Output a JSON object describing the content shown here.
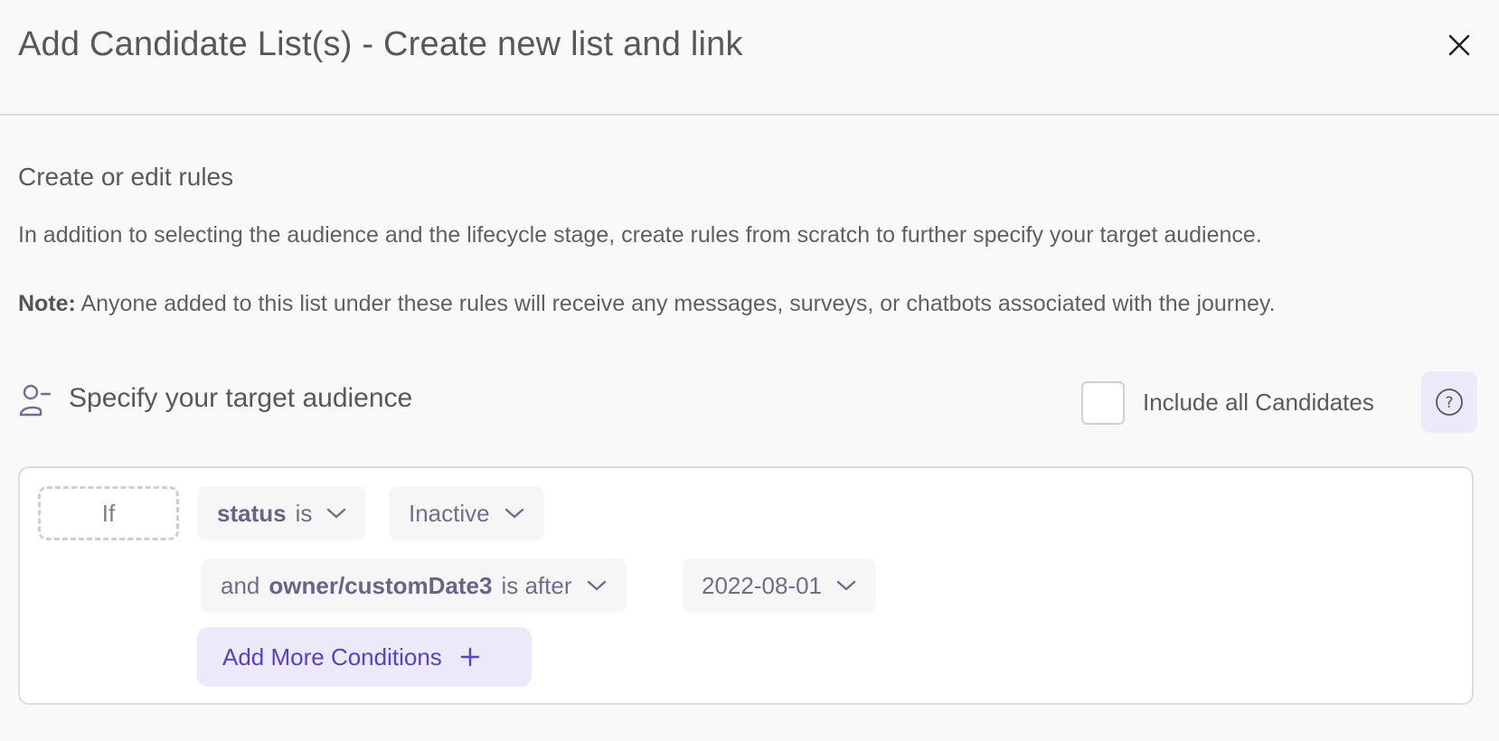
{
  "dialog": {
    "title": "Add Candidate List(s) - Create new list and link"
  },
  "rules_section": {
    "title": "Create or edit rules",
    "description": "In addition to selecting the audience and the lifecycle stage, create rules from scratch to further specify your target audience.",
    "note_label": "Note:",
    "note_text": "Anyone added to this list under these rules will receive any messages, surveys, or chatbots associated with the journey."
  },
  "audience": {
    "title": "Specify your target audience",
    "include_all_label": "Include all Candidates",
    "include_all_checked": false
  },
  "conditions": {
    "if_label": "If",
    "rows": [
      {
        "connector": "",
        "field": "status",
        "operator": "is",
        "value": "Inactive"
      },
      {
        "connector": "and",
        "field": "owner/customDate3",
        "operator": "is after",
        "value": "2022-08-01"
      }
    ],
    "add_more_label": "Add More Conditions"
  },
  "colors": {
    "accent": "#5a3fc8",
    "accent_bg": "#ece9fb",
    "chip_bg": "#f6f6f6",
    "chip_text": "#6e6e8c"
  },
  "icons": [
    "close-icon",
    "user-minus-icon",
    "help-icon",
    "chevron-down-icon",
    "plus-icon"
  ]
}
